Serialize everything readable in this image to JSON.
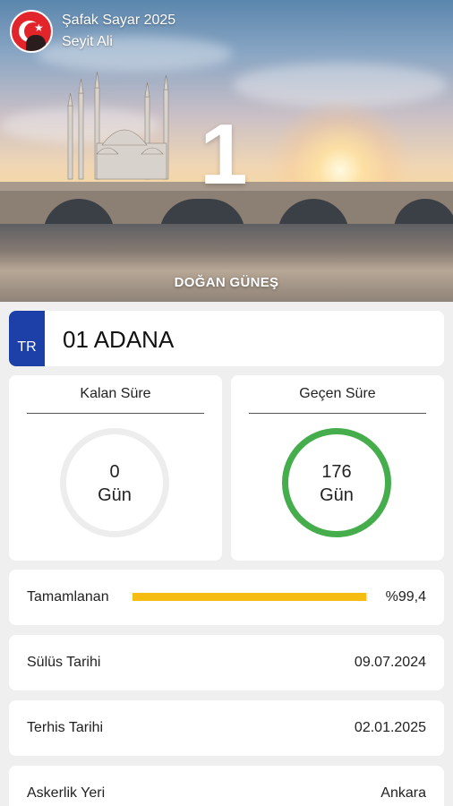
{
  "header": {
    "app_title": "Şafak Sayar 2025",
    "user_name": "Seyit Ali",
    "day_number": "1",
    "sunrise_label": "DOĞAN GÜNEŞ"
  },
  "plate": {
    "country_code": "TR",
    "city": "01 ADANA"
  },
  "remaining": {
    "title": "Kalan Süre",
    "value": "0",
    "unit": "Gün"
  },
  "elapsed": {
    "title": "Geçen Süre",
    "value": "176",
    "unit": "Gün"
  },
  "progress": {
    "label": "Tamamlanan",
    "value_text": "%99,4",
    "fraction": 0.994,
    "color": "#f5bc12"
  },
  "rows": {
    "induction": {
      "label": "Sülüs Tarihi",
      "value": "09.07.2024"
    },
    "discharge": {
      "label": "Terhis Tarihi",
      "value": "02.01.2025"
    },
    "location": {
      "label": "Askerlik Yeri",
      "value": "Ankara"
    }
  },
  "colors": {
    "ring_done": "#46ad4d",
    "plate_blue": "#1d3fa8",
    "logo_red": "#e2242b"
  }
}
